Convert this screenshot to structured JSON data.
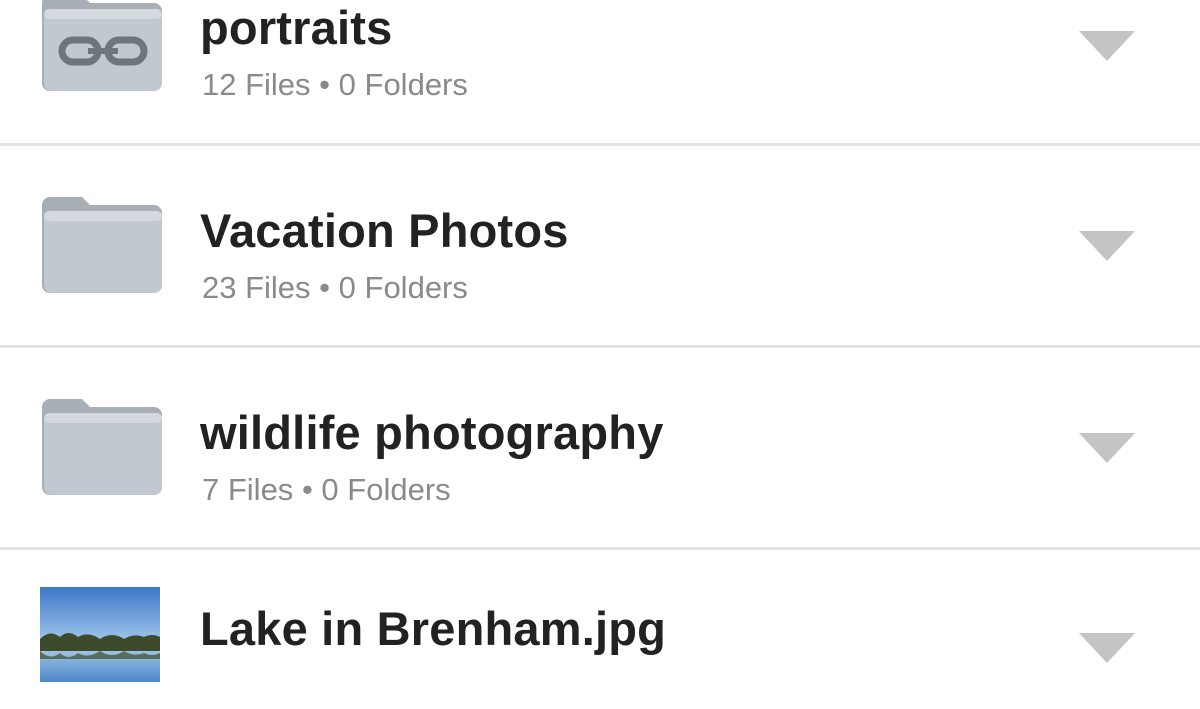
{
  "items": [
    {
      "name": "portraits",
      "files": "12 Files",
      "sep": "•",
      "folders": "0 Folders",
      "icon": "shared-folder-icon"
    },
    {
      "name": "Vacation Photos",
      "files": "23 Files",
      "sep": "•",
      "folders": "0 Folders",
      "icon": "folder-icon"
    },
    {
      "name": "wildlife photography",
      "files": "7 Files",
      "sep": "•",
      "folders": "0 Folders",
      "icon": "folder-icon"
    },
    {
      "name": "Lake in Brenham.jpg",
      "icon": "image-thumbnail"
    }
  ],
  "menu_icon": "chevron-down-icon",
  "colors": {
    "title": "#222222",
    "subtitle": "#8a8a8a",
    "folder": "#b9c0c8",
    "divider": "#e3e3e3",
    "menu_arrow": "#c4c4c4"
  }
}
